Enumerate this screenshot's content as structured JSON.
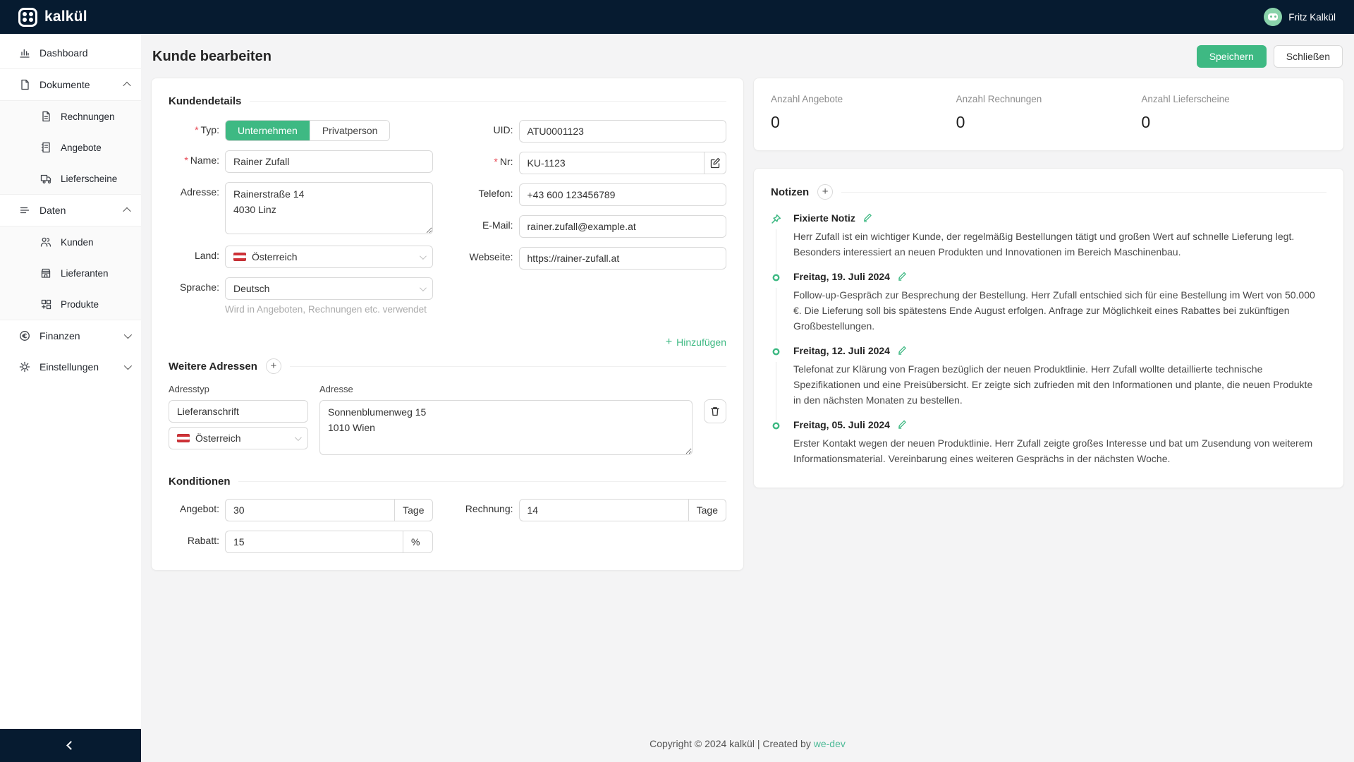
{
  "topbar": {
    "brand": "kalkül",
    "user_name": "Fritz Kalkül"
  },
  "page": {
    "title": "Kunde bearbeiten",
    "save_label": "Speichern",
    "close_label": "Schließen",
    "required_marker": "*"
  },
  "sidebar": {
    "dashboard": "Dashboard",
    "dokumente": "Dokumente",
    "rechnungen": "Rechnungen",
    "angebote": "Angebote",
    "lieferscheine": "Lieferscheine",
    "daten": "Daten",
    "kunden": "Kunden",
    "lieferanten": "Lieferanten",
    "produkte": "Produkte",
    "finanzen": "Finanzen",
    "einstellungen": "Einstellungen"
  },
  "details": {
    "section_title": "Kundendetails",
    "typ_label": "Typ:",
    "typ_unternehmen": "Unternehmen",
    "typ_privatperson": "Privatperson",
    "name_label": "Name:",
    "name_value": "Rainer Zufall",
    "adresse_label": "Adresse:",
    "adresse_value": "Rainerstraße 14\n4030 Linz",
    "land_label": "Land:",
    "land_value": "Österreich",
    "sprache_label": "Sprache:",
    "sprache_value": "Deutsch",
    "sprache_hint": "Wird in Angeboten, Rechnungen etc. verwendet",
    "uid_label": "UID:",
    "uid_value": "ATU0001123",
    "nr_label": "Nr:",
    "nr_value": "KU-1123",
    "telefon_label": "Telefon:",
    "telefon_value": "+43 600 123456789",
    "email_label": "E-Mail:",
    "email_value": "rainer.zufall@example.at",
    "webseite_label": "Webseite:",
    "webseite_value": "https://rainer-zufall.at"
  },
  "addresses": {
    "section_title": "Weitere Adressen",
    "add_link": "Hinzufügen",
    "col_adresstyp": "Adresstyp",
    "col_adresse": "Adresse",
    "adresstyp_value": "Lieferanschrift",
    "land_value": "Österreich",
    "adresse_value": "Sonnenblumenweg 15\n1010 Wien"
  },
  "konditionen": {
    "section_title": "Konditionen",
    "angebot_label": "Angebot:",
    "angebot_value": "30",
    "angebot_unit": "Tage",
    "rechnung_label": "Rechnung:",
    "rechnung_value": "14",
    "rechnung_unit": "Tage",
    "rabatt_label": "Rabatt:",
    "rabatt_value": "15",
    "rabatt_unit": "%"
  },
  "stats": {
    "angebote_label": "Anzahl Angebote",
    "angebote_value": "0",
    "rechnungen_label": "Anzahl Rechnungen",
    "rechnungen_value": "0",
    "lieferscheine_label": "Anzahl Lieferscheine",
    "lieferscheine_value": "0"
  },
  "notes": {
    "section_title": "Notizen",
    "items": [
      {
        "title": "Fixierte Notiz",
        "text": "Herr Zufall ist ein wichtiger Kunde, der regelmäßig Bestellungen tätigt und großen Wert auf schnelle Lieferung legt. Besonders interessiert an neuen Produkten und Innovationen im Bereich Maschinenbau."
      },
      {
        "title": "Freitag, 19. Juli 2024",
        "text": "Follow-up-Gespräch zur Besprechung der Bestellung. Herr Zufall entschied sich für eine Bestellung im Wert von 50.000 €. Die Lieferung soll bis spätestens Ende August erfolgen. Anfrage zur Möglichkeit eines Rabattes bei zukünftigen Großbestellungen."
      },
      {
        "title": "Freitag, 12. Juli 2024",
        "text": "Telefonat zur Klärung von Fragen bezüglich der neuen Produktlinie. Herr Zufall wollte detaillierte technische Spezifikationen und eine Preisübersicht. Er zeigte sich zufrieden mit den Informationen und plante, die neuen Produkte in den nächsten Monaten zu bestellen."
      },
      {
        "title": "Freitag, 05. Juli 2024",
        "text": "Erster Kontakt wegen der neuen Produktlinie. Herr Zufall zeigte großes Interesse und bat um Zusendung von weiterem Informationsmaterial. Vereinbarung eines weiteren Gesprächs in der nächsten Woche."
      }
    ]
  },
  "footer": {
    "text": "Copyright © 2024 kalkül | Created by ",
    "link": "we-dev"
  },
  "colors": {
    "accent": "#3eb983",
    "topbar": "#061b30",
    "danger": "#e64552"
  }
}
